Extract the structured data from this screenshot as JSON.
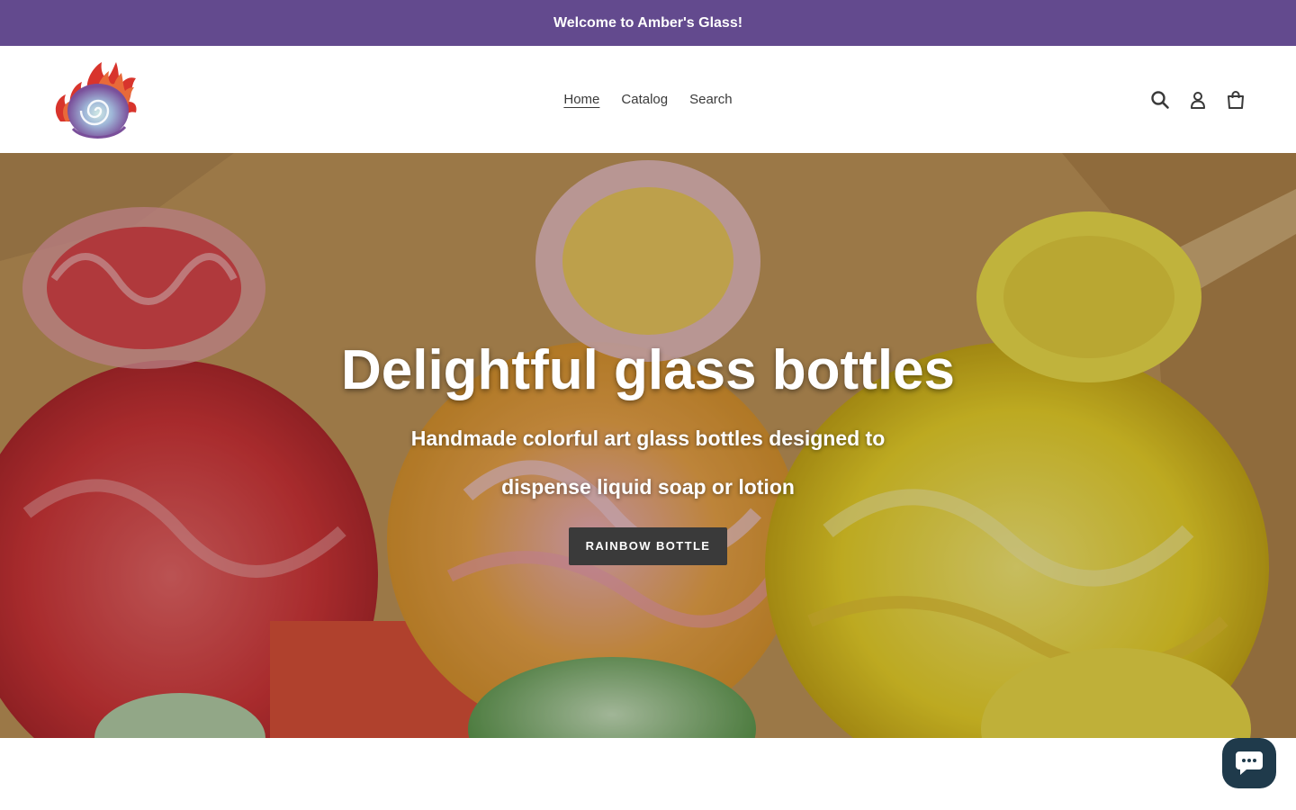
{
  "announcement": {
    "text": "Welcome to Amber's Glass!",
    "background": "#634a8e"
  },
  "header": {
    "logo_name": "amber-glass-flame-spiral-logo",
    "nav": [
      {
        "label": "Home",
        "active": true
      },
      {
        "label": "Catalog",
        "active": false
      },
      {
        "label": "Search",
        "active": false
      }
    ],
    "icons": [
      "search-icon",
      "account-icon",
      "cart-icon"
    ]
  },
  "hero": {
    "title": "Delightful glass bottles",
    "subtitle": "Handmade colorful art glass bottles designed to dispense liquid soap or lotion",
    "button_label": "Rainbow bottle",
    "button_color": "#3a3a3a"
  },
  "chat": {
    "icon": "chat-bubble-icon",
    "color": "#1f3a4b"
  }
}
